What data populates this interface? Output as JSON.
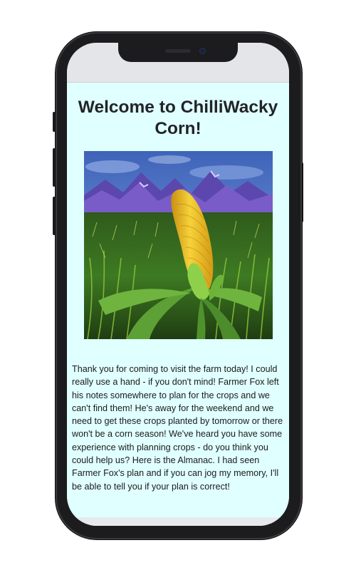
{
  "page": {
    "heading": "Welcome to ChilliWacky Corn!",
    "hero_image": {
      "description": "Painting of a single ear of corn rising above a cornfield with purple mountains under a blue sky",
      "colors": {
        "sky": "#4b6fc0",
        "mountains": "#6a54b8",
        "corn": "#f0c22a",
        "leaves": "#4f8a2a"
      }
    },
    "intro_text": "Thank you for coming to visit the farm today! I could really use a hand - if you don't mind! Farmer Fox left his notes somewhere to plan for the crops and we can't find them! He's away for the weekend and we need to get these crops planted by tomorrow or there won't be a corn season! We've heard you have some experience with planning crops - do you think you could help us? Here is the Almanac. I had seen Farmer Fox's plan and if you can jog my memory, I'll be able to tell you if your plan is correct!",
    "background_color": "#e0ffff"
  }
}
